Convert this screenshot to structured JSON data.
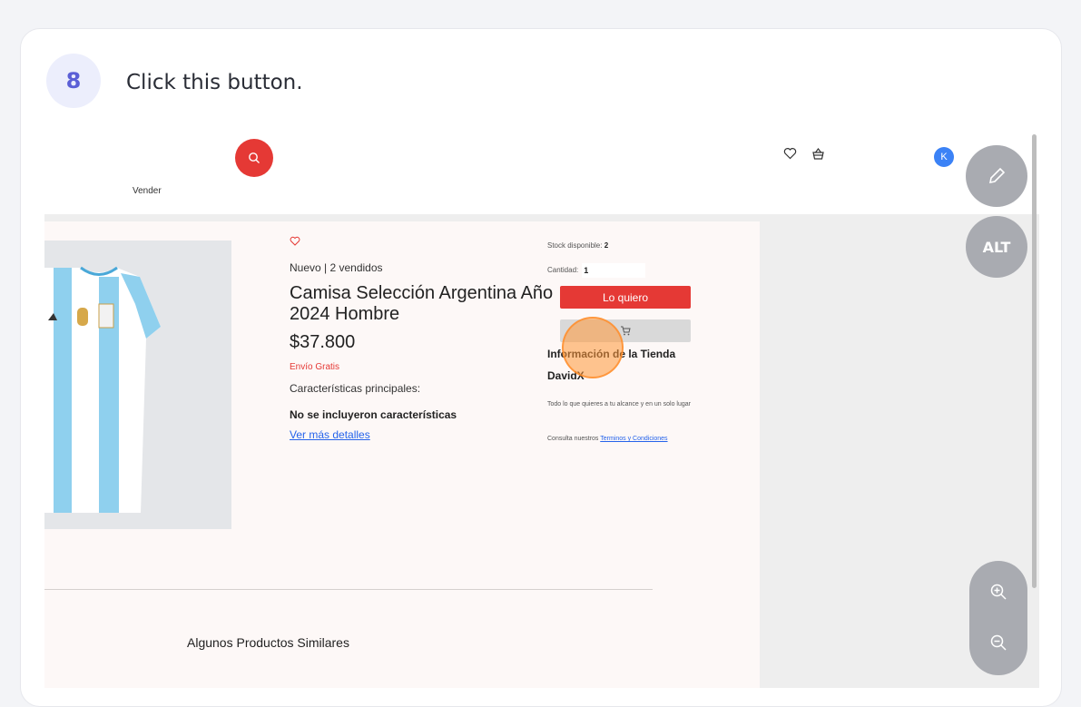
{
  "step": {
    "number": "8",
    "instruction": "Click this button."
  },
  "header": {
    "vender_label": "Vender",
    "avatar_initial": "K"
  },
  "product": {
    "condition": "Nuevo | 2 vendidos",
    "title": "Camisa Selección Argentina Año 2024 Hombre",
    "price": "$37.800",
    "shipping": "Envío Gratis",
    "features_heading": "Características principales:",
    "features_none": "No se incluyeron características",
    "more_details": "Ver más detalles"
  },
  "purchase": {
    "stock_label": "Stock disponible:",
    "stock_value": "2",
    "qty_label": "Cantidad:",
    "qty_value": "1",
    "buy_label": "Lo quiero"
  },
  "store": {
    "heading": "Información de la Tienda",
    "name": "DavidX",
    "description": "Todo lo que quieres a tu alcance y en un solo lugar",
    "terms_prefix": "Consulta nuestros",
    "terms_link": "Terminos y Condiciones"
  },
  "similar_heading": "Algunos Productos Similares",
  "tools": {
    "alt_label": "ALT"
  },
  "colors": {
    "accent": "#e53935",
    "badge": "#5b5fd6",
    "highlight": "#ff9838",
    "link": "#2563eb"
  },
  "icons": [
    "search-icon",
    "heart-icon",
    "basket-icon",
    "cart-icon",
    "pencil-icon",
    "zoom-in-icon",
    "zoom-out-icon"
  ]
}
